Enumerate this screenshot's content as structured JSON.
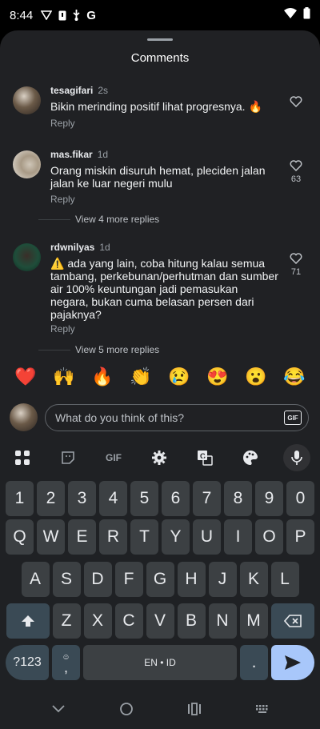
{
  "status_bar": {
    "time": "8:44",
    "left_icons": [
      "vpn-icon",
      "notification-icon",
      "usb-icon",
      "google-icon"
    ],
    "right_icons": [
      "wifi-icon",
      "battery-icon"
    ]
  },
  "sheet": {
    "title": "Comments"
  },
  "comments": [
    {
      "username": "tesagifari",
      "time": "2s",
      "text": "Bikin merinding positif lihat progresnya. 🔥",
      "reply_label": "Reply",
      "likes": ""
    },
    {
      "username": "mas.fikar",
      "time": "1d",
      "text": "Orang miskin disuruh hemat, pleciden jalan jalan ke luar negeri mulu",
      "reply_label": "Reply",
      "likes": "63",
      "more_replies": "View 4 more replies"
    },
    {
      "username": "rdwnilyas",
      "time": "1d",
      "text": "⚠️ ada yang lain, coba hitung kalau semua tambang, perkebunan/perhutman dan sumber air 100% keuntungan jadi pemasukan negara, bukan cuma belasan persen dari pajaknya?",
      "reply_label": "Reply",
      "likes": "71",
      "more_replies": "View 5 more replies"
    }
  ],
  "emoji_bar": [
    "❤️",
    "🙌",
    "🔥",
    "👏",
    "😢",
    "😍",
    "😮",
    "😂"
  ],
  "composer": {
    "placeholder": "What do you think of this?",
    "gif_label": "GIF"
  },
  "keyboard": {
    "toolbar": {
      "gif_label": "GIF"
    },
    "rows": {
      "numbers": [
        "1",
        "2",
        "3",
        "4",
        "5",
        "6",
        "7",
        "8",
        "9",
        "0"
      ],
      "row1": [
        "Q",
        "W",
        "E",
        "R",
        "T",
        "Y",
        "U",
        "I",
        "O",
        "P"
      ],
      "row2": [
        "A",
        "S",
        "D",
        "F",
        "G",
        "H",
        "J",
        "K",
        "L"
      ],
      "row3": [
        "Z",
        "X",
        "C",
        "V",
        "B",
        "N",
        "M"
      ]
    },
    "symbols_label": "?123",
    "comma_label": ",",
    "space_label": "EN • ID",
    "period_label": "."
  },
  "colors": {
    "sheet_bg": "#202124",
    "keyboard_bg": "#1f2124",
    "key_bg": "#3c4043",
    "action_key_bg": "#a8c7fa"
  }
}
